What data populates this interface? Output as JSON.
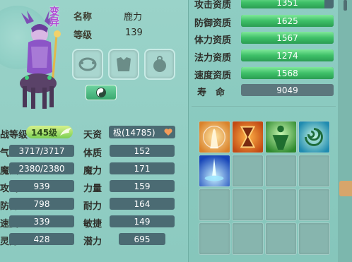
{
  "character": {
    "name_vertical": "变异",
    "name_label": "名称",
    "name_value": "鹿力",
    "level_label": "等级",
    "level_value": "139"
  },
  "stats_left": {
    "rows": [
      {
        "label": "战等级",
        "value": ""
      },
      {
        "label": "气血",
        "value": "3717/3717"
      },
      {
        "label": "魔法",
        "value": "2380/2380"
      },
      {
        "label": "攻击",
        "value": "939"
      },
      {
        "label": "防御",
        "value": "798"
      },
      {
        "label": "速度",
        "value": "339"
      },
      {
        "label": "灵力",
        "value": "428"
      }
    ],
    "battle_level_badge": "145级"
  },
  "stats_mid": {
    "rows": [
      {
        "label": "天资",
        "value": "极(14785)"
      },
      {
        "label": "体质",
        "value": "152"
      },
      {
        "label": "魔力",
        "value": "171"
      },
      {
        "label": "力量",
        "value": "159"
      },
      {
        "label": "耐力",
        "value": "164"
      },
      {
        "label": "敏捷",
        "value": "149"
      },
      {
        "label": "潜力",
        "value": "695"
      }
    ]
  },
  "aptitudes": [
    {
      "label": "攻击资质",
      "value": "1351",
      "fill": 0.9
    },
    {
      "label": "防御资质",
      "value": "1625",
      "fill": 1.0
    },
    {
      "label": "体力资质",
      "value": "1567",
      "fill": 1.0
    },
    {
      "label": "法力资质",
      "value": "1274",
      "fill": 1.0
    },
    {
      "label": "速度资质",
      "value": "1568",
      "fill": 1.0
    }
  ],
  "lifespan": {
    "label": "寿　命",
    "value": "9049"
  },
  "icons": {
    "equip_1": "collar-icon",
    "equip_2": "armor-icon",
    "equip_3": "charm-icon",
    "yinyang": "yin-yang-icon",
    "heart": "heart-icon"
  },
  "colors": {
    "accent_green": "#3ec068",
    "value_box": "#4b6b73",
    "panel_bg": "#9ad3c9"
  }
}
